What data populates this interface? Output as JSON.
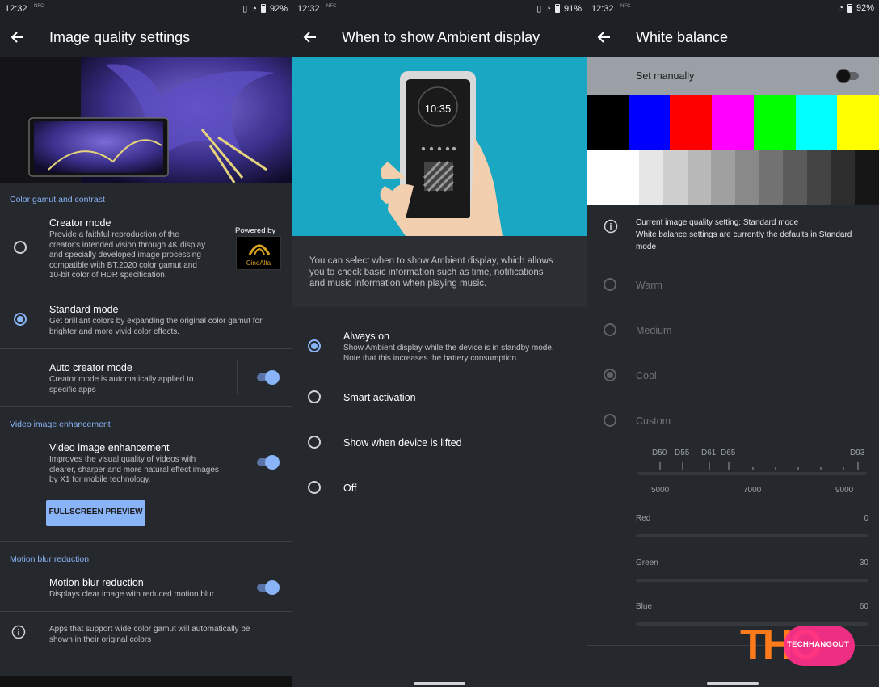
{
  "status": [
    {
      "time": "12:32",
      "battery": "92%"
    },
    {
      "time": "12:32",
      "battery": "91%"
    },
    {
      "time": "12:32",
      "battery": "92%"
    }
  ],
  "image_quality": {
    "title": "Image quality settings",
    "section_color": "Color gamut and contrast",
    "creator_title": "Creator mode",
    "creator_sub": [
      "Provide a faithful reproduction of the",
      "creator's intended vision through 4K display",
      "and specially developed image processing",
      "compatible with BT.2020 color gamut and",
      "10-bit color of HDR specification."
    ],
    "powered_by": "Powered by",
    "cinealta": "CineAlta",
    "standard_title": "Standard mode",
    "standard_sub": [
      "Get brilliant colors by expanding the original color gamut for",
      "brighter and more vivid color effects."
    ],
    "auto_title": "Auto creator mode",
    "auto_sub": [
      "Creator mode is automatically applied to",
      "specific apps"
    ],
    "section_video": "Video image enhancement",
    "video_title": "Video image enhancement",
    "video_sub": [
      "Improves the visual quality of videos with",
      "clearer, sharper and more natural effect images",
      "by X1 for mobile technology."
    ],
    "preview_btn": "FULLSCREEN PREVIEW",
    "section_motion": "Motion blur reduction",
    "motion_title": "Motion blur reduction",
    "motion_sub": "Displays clear image with reduced motion blur",
    "info": [
      "Apps that support wide color gamut will automatically be",
      "shown in their original colors"
    ]
  },
  "ambient": {
    "title": "When to show Ambient display",
    "clock": "10:35",
    "description": [
      "You can select when to show Ambient display, which allows",
      "you to check basic information such as time, notifications",
      "and music information when playing music."
    ],
    "options": [
      {
        "label": "Always on",
        "sub": [
          "Show Ambient display while the device is in standby mode.",
          "Note that this increases the battery consumption."
        ],
        "checked": true
      },
      {
        "label": "Smart activation",
        "sub": [],
        "checked": false
      },
      {
        "label": "Show when device is lifted",
        "sub": [],
        "checked": false
      },
      {
        "label": "Off",
        "sub": [],
        "checked": false
      }
    ]
  },
  "white_balance": {
    "title": "White balance",
    "set_manually": "Set manually",
    "color_bars": [
      "#000000",
      "#0000ff",
      "#ff0000",
      "#ff00ff",
      "#00ff00",
      "#00ffff",
      "#ffff00"
    ],
    "gray_bars": [
      "#ffffff",
      "#e6e6e6",
      "#cfcfcf",
      "#b8b8b8",
      "#a0a0a0",
      "#898989",
      "#727272",
      "#5b5b5b",
      "#444444",
      "#2d2d2d",
      "#161616"
    ],
    "info": [
      "Current image quality setting: Standard mode",
      "White balance settings are currently the defaults in Standard",
      "mode"
    ],
    "presets": [
      {
        "label": "Warm",
        "checked": false
      },
      {
        "label": "Medium",
        "checked": false
      },
      {
        "label": "Cool",
        "checked": true
      },
      {
        "label": "Custom",
        "checked": false
      }
    ],
    "d_labels": [
      "D50",
      "D55",
      "D61",
      "D65",
      "D93"
    ],
    "k_labels": [
      "5000",
      "7000",
      "9000"
    ],
    "rgb": [
      {
        "label": "Red",
        "value": "0"
      },
      {
        "label": "Green",
        "value": "30"
      },
      {
        "label": "Blue",
        "value": "60"
      }
    ]
  },
  "watermark": {
    "logo": "THO",
    "text": "TECHHANGOUT"
  }
}
